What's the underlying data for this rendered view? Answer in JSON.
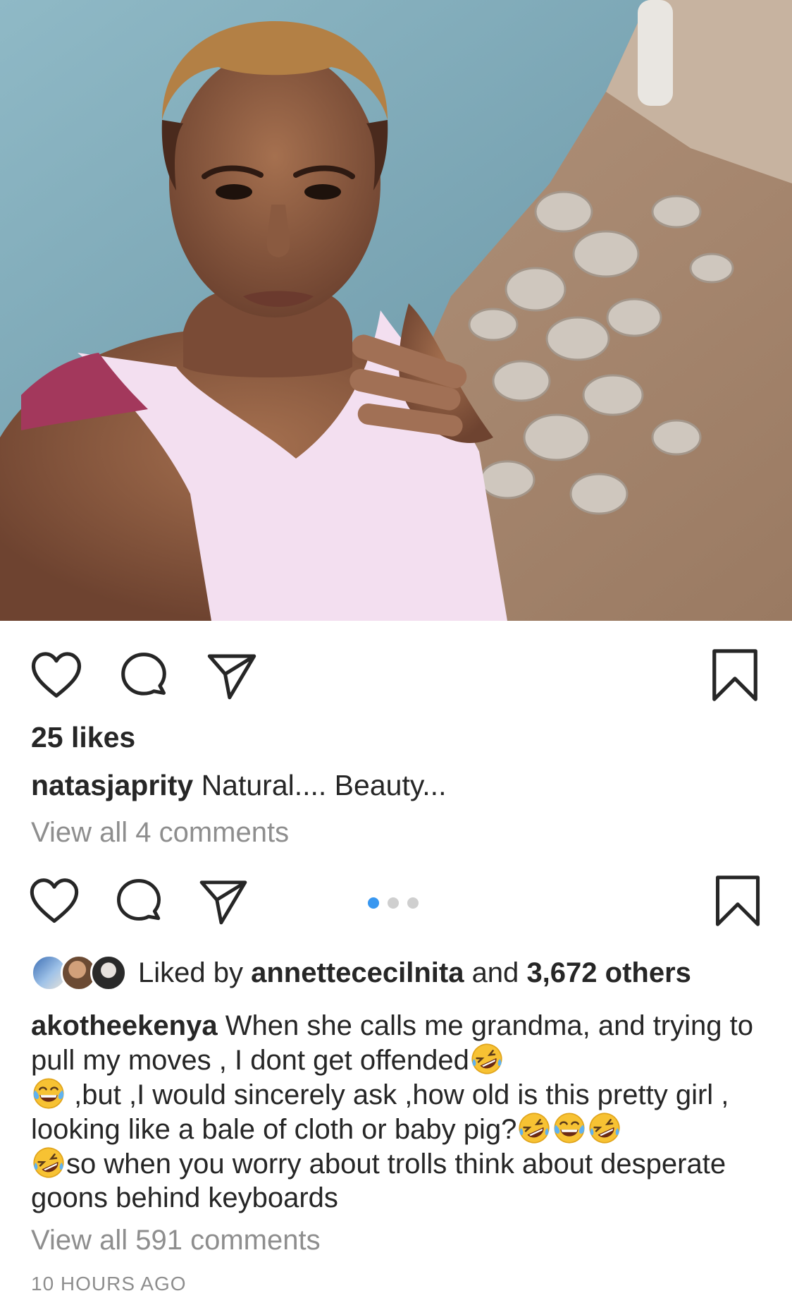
{
  "post1": {
    "likes": "25 likes",
    "caption_user": "natasjaprity",
    "caption_text": "Natural.... Beauty...",
    "view_comments": "View all 4 comments"
  },
  "post2": {
    "carousel_dots": 3,
    "carousel_active_index": 0,
    "liked_by_prefix": "Liked by",
    "liked_by_user": "annettececilnita",
    "liked_by_and": "and",
    "liked_by_others": "3,672 others",
    "caption_user": "akotheekenya",
    "caption_part1": "When she calls me grandma, and trying to pull my moves , I dont get offended",
    "caption_part2": ",but ,I would sincerely ask ,how old is this pretty girl , looking like a bale of cloth or baby pig?",
    "caption_part3": "so when you worry about trolls think about desperate goons behind keyboards",
    "view_comments": "View all 591 comments",
    "timestamp": "10 HOURS AGO"
  },
  "icons": {
    "like": "heart-icon",
    "comment": "comment-icon",
    "share": "paper-plane-icon",
    "save": "bookmark-icon",
    "emoji_rofl": "rolling-laughing-emoji",
    "emoji_joy": "tears-of-joy-emoji"
  },
  "colors": {
    "text": "#262626",
    "muted": "#8e8e8e",
    "dot_active": "#3897f0",
    "dot_inactive": "#cfcfcf"
  }
}
